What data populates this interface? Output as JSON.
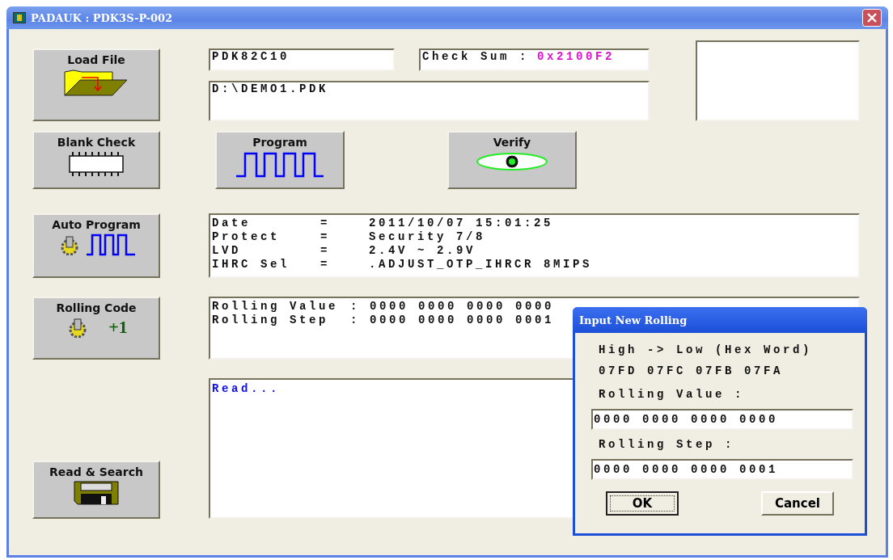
{
  "window": {
    "title": "PADAUK : PDK3S-P-002"
  },
  "side_buttons": [
    {
      "label": "Load File",
      "kind": "folder"
    },
    {
      "label": "Blank Check",
      "kind": "chip"
    },
    {
      "label": "Auto Program",
      "kind": "auto"
    },
    {
      "label": "Rolling Code",
      "kind": "rolling",
      "badge": "+1"
    },
    {
      "label": "Read & Search",
      "kind": "floppy"
    }
  ],
  "chip_name": "PDK82C10",
  "checksum": {
    "label": "Check Sum :",
    "value": "0x2100F2"
  },
  "file_path": "D:\\DEMO1.PDK",
  "action_buttons": [
    {
      "label": "Program",
      "kind": "wave"
    },
    {
      "label": "Verify",
      "kind": "eye"
    }
  ],
  "info_lines": [
    {
      "label": "Date",
      "separator": "=",
      "value": "2011/10/07  15:01:25"
    },
    {
      "label": "Protect",
      "separator": "=",
      "value": "Security 7/8"
    },
    {
      "label": "LVD",
      "separator": "=",
      "value": "2.4V ~ 2.9V"
    },
    {
      "label": "IHRC Sel",
      "separator": "=",
      "value": ".ADJUST_OTP_IHRCR  8MIPS"
    }
  ],
  "rolling_lines": [
    {
      "label": "Rolling Value",
      "separator": ":",
      "value": "0000 0000 0000 0000"
    },
    {
      "label": "Rolling Step",
      "separator": ":",
      "value": "0000 0000 0000 0001"
    }
  ],
  "log": "Read...",
  "dialog": {
    "title": "Input New Rolling",
    "hint": "High -> Low (Hex Word)",
    "addresses": "07FD 07FC 07FB 07FA",
    "fields": [
      {
        "label": "Rolling Value :",
        "value": "0000 0000 0000 0000"
      },
      {
        "label": "Rolling  Step :",
        "value": "0000 0000 0000 0001"
      }
    ],
    "buttons": [
      {
        "label": "OK",
        "default": true
      },
      {
        "label": "Cancel",
        "default": false
      }
    ]
  }
}
